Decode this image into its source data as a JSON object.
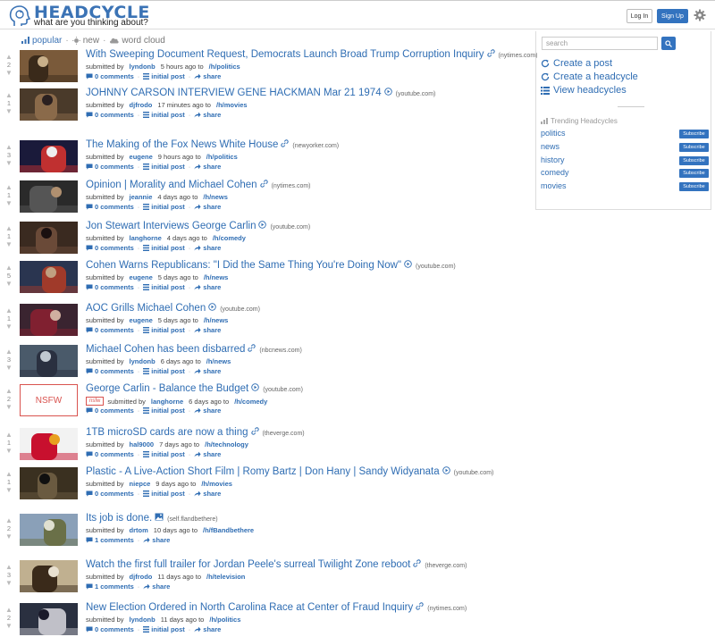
{
  "header": {
    "brand": "HEADCYCLE",
    "tagline": "what are you thinking about?",
    "login_label": "Log In",
    "signup_label": "Sign Up"
  },
  "filters": {
    "popular": "popular",
    "new": "new",
    "word_cloud": "word cloud"
  },
  "posts": [
    {
      "score": "2",
      "title": "With Sweeping Document Request, Democrats Launch Broad Trump Corruption Inquiry",
      "type": "link",
      "domain": "(nytimes.com)",
      "submitted": "submitted by",
      "user": "lyndonb",
      "time": "5 hours ago to",
      "category": "/h/politics",
      "comments": "0 comments",
      "initial": "initial post",
      "share": "share"
    },
    {
      "score": "1",
      "title": "JOHNNY CARSON INTERVIEW GENE HACKMAN Mar 21 1974",
      "type": "video",
      "domain": "(youtube.com)",
      "submitted": "submitted by",
      "user": "djfrodo",
      "time": "17 minutes ago to",
      "category": "/h/movies",
      "comments": "0 comments",
      "initial": "initial post",
      "share": "share"
    },
    {
      "score": "3",
      "title": "The Making of the Fox News White House",
      "type": "link",
      "domain": "(newyorker.com)",
      "submitted": "submitted by",
      "user": "eugene",
      "time": "9 hours ago to",
      "category": "/h/politics",
      "comments": "0 comments",
      "initial": "initial post",
      "share": "share"
    },
    {
      "score": "1",
      "title": "Opinion | Morality and Michael Cohen",
      "type": "link",
      "domain": "(nytimes.com)",
      "submitted": "submitted by",
      "user": "jeannie",
      "time": "4 days ago to",
      "category": "/h/news",
      "comments": "0 comments",
      "initial": "initial post",
      "share": "share"
    },
    {
      "score": "1",
      "title": "Jon Stewart Interviews George Carlin",
      "type": "video",
      "domain": "(youtube.com)",
      "submitted": "submitted by",
      "user": "langhorne",
      "time": "4 days ago to",
      "category": "/h/comedy",
      "comments": "0 comments",
      "initial": "initial post",
      "share": "share"
    },
    {
      "score": "5",
      "title": "Cohen Warns Republicans: \"I Did the Same Thing You're Doing Now\"",
      "type": "video",
      "domain": "(youtube.com)",
      "submitted": "submitted by",
      "user": "eugene",
      "time": "5 days ago to",
      "category": "/h/news",
      "comments": "0 comments",
      "initial": "initial post",
      "share": "share"
    },
    {
      "score": "1",
      "title": "AOC Grills Michael Cohen",
      "type": "video",
      "domain": "(youtube.com)",
      "submitted": "submitted by",
      "user": "eugene",
      "time": "5 days ago to",
      "category": "/h/news",
      "comments": "0 comments",
      "initial": "initial post",
      "share": "share"
    },
    {
      "score": "3",
      "title": "Michael Cohen has been disbarred",
      "type": "link",
      "domain": "(nbcnews.com)",
      "submitted": "submitted by",
      "user": "lyndonb",
      "time": "6 days ago to",
      "category": "/h/news",
      "comments": "0 comments",
      "initial": "initial post",
      "share": "share"
    },
    {
      "score": "2",
      "title": "George Carlin - Balance the Budget",
      "type": "video",
      "domain": "(youtube.com)",
      "submitted": "submitted by",
      "user": "langhorne",
      "time": "6 days ago to",
      "category": "/h/comedy",
      "comments": "0 comments",
      "initial": "initial post",
      "share": "share",
      "nsfw": "nsfw",
      "thumb_label": "NSFW"
    },
    {
      "score": "1",
      "title": "1TB microSD cards are now a thing",
      "type": "link",
      "domain": "(theverge.com)",
      "submitted": "submitted by",
      "user": "hal9000",
      "time": "7 days ago to",
      "category": "/h/technology",
      "comments": "0 comments",
      "initial": "initial post",
      "share": "share"
    },
    {
      "score": "1",
      "title": "Plastic - A Live-Action Short Film | Romy Bartz | Don Hany | Sandy Widyanata",
      "type": "video",
      "domain": "(youtube.com)",
      "submitted": "submitted by",
      "user": "niepce",
      "time": "9 days ago to",
      "category": "/h/movies",
      "comments": "0 comments",
      "initial": "initial post",
      "share": "share"
    },
    {
      "score": "2",
      "title": "Its job is done.",
      "type": "image",
      "domain": "(self.flandbethere)",
      "submitted": "submitted by",
      "user": "drtom",
      "time": "10 days ago to",
      "category": "/h/fBandbethere",
      "comments": "1 comments",
      "share": "share"
    },
    {
      "score": "3",
      "title": "Watch the first full trailer for Jordan Peele's surreal Twilight Zone reboot",
      "type": "link",
      "domain": "(theverge.com)",
      "submitted": "submitted by",
      "user": "djfrodo",
      "time": "11 days ago to",
      "category": "/h/television",
      "comments": "1 comments",
      "share": "share"
    },
    {
      "score": "2",
      "title": "New Election Ordered in North Carolina Race at Center of Fraud Inquiry",
      "type": "link",
      "domain": "(nytimes.com)",
      "submitted": "submitted by",
      "user": "lyndonb",
      "time": "11 days ago to",
      "category": "/h/politics",
      "comments": "0 comments",
      "initial": "initial post",
      "share": "share"
    }
  ],
  "sidebar": {
    "search_placeholder": "search",
    "create_post": "Create a post",
    "create_headcycle": "Create a headcycle",
    "view_headcycles": "View headcycles",
    "trending_title": "Trending Headcycles",
    "trending": [
      {
        "name": "politics",
        "action": "Subscribe"
      },
      {
        "name": "news",
        "action": "Subscribe"
      },
      {
        "name": "history",
        "action": "Subscribe"
      },
      {
        "name": "comedy",
        "action": "Subscribe"
      },
      {
        "name": "movies",
        "action": "Subscribe"
      }
    ]
  },
  "colors": {
    "accent": "#3373bf",
    "link": "#2f6db3",
    "nsfw": "#d9534f"
  }
}
